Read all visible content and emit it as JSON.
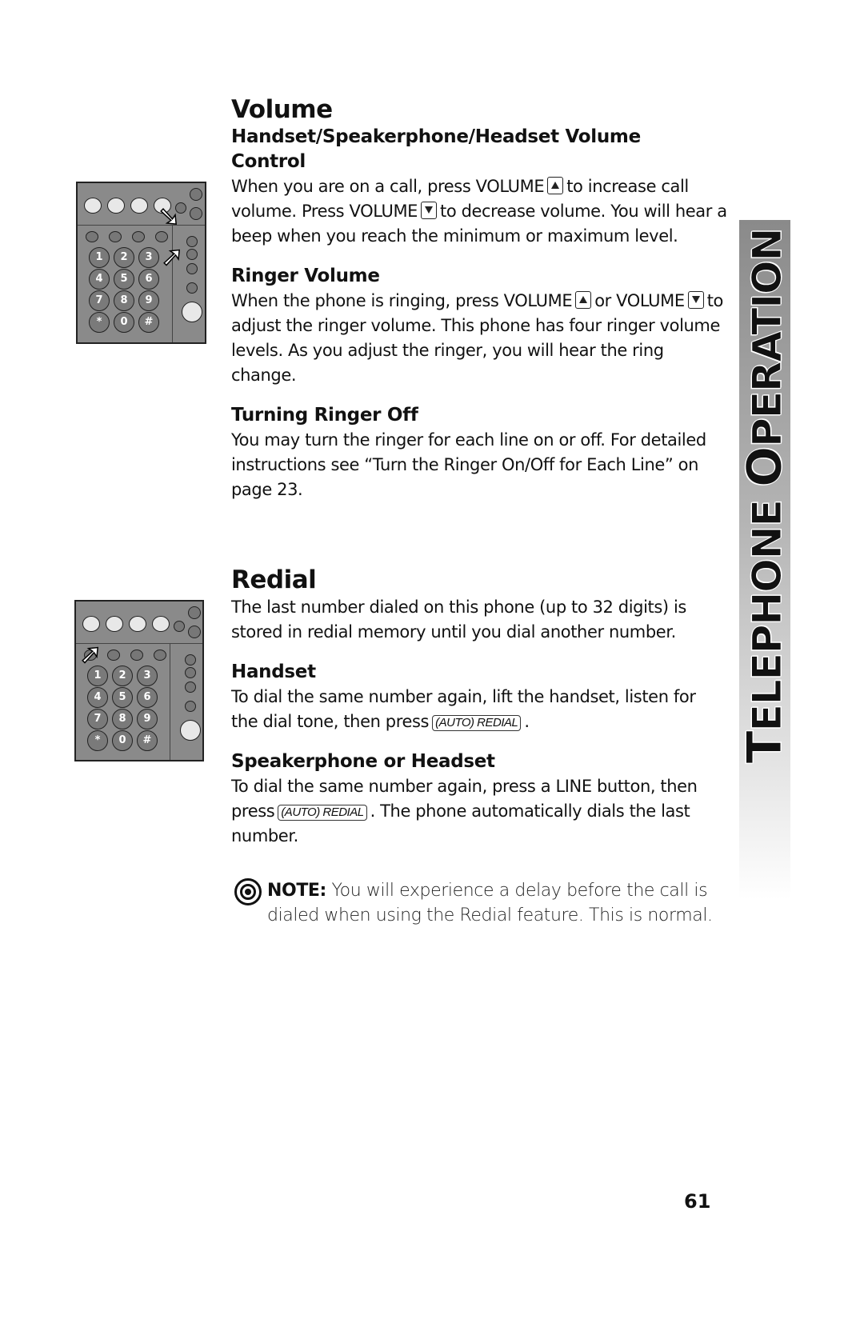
{
  "volume": {
    "title": "Volume",
    "handset_heading": "Handset/Speakerphone/Headset Volume Control",
    "handset_text_1": "When you are on a call, press VOLUME",
    "handset_text_2": "to increase call volume.  Press  VOLUME",
    "handset_text_3": "to decrease volume. You will hear a beep when you reach the minimum or maximum level.",
    "ringer_heading": "Ringer Volume",
    "ringer_text_1": "When the phone is ringing, press VOLUME",
    "ringer_text_2": "or VOLUME",
    "ringer_text_3": "to adjust the ringer volume. This phone has four ringer volume levels.  As you adjust the ringer, you will hear the ring change.",
    "off_heading": "Turning Ringer Off",
    "off_text": "You may turn the ringer for each line on or off.  For detailed instructions see “Turn the Ringer On/Off for Each Line” on page 23."
  },
  "redial": {
    "title": "Redial",
    "intro": "The last number dialed on this phone (up to 32 digits) is stored in redial memory until you dial another number.",
    "handset_heading": "Handset",
    "handset_text_1": "To dial the same number again, lift the handset, listen for the dial tone, then press",
    "handset_text_2": ".",
    "speaker_heading": "Speakerphone or Headset",
    "speaker_text_1": "To dial the same number again, press a LINE button, then press",
    "speaker_text_2": ".  The phone automatically dials the last number.",
    "button_label": "(AUTO) REDIAL"
  },
  "note": {
    "label": "NOTE:",
    "text": "You will experience a delay before the call is dialed when using the Redial feature.  This is normal."
  },
  "side_tab": {
    "first_letter": "T",
    "word1": "ELEPHONE",
    "second_letter": "O",
    "word2": "PERATION"
  },
  "page_number": "61",
  "keypad": [
    "1",
    "2",
    "3",
    "4",
    "5",
    "6",
    "7",
    "8",
    "9",
    "*",
    "0",
    "#"
  ],
  "icons": {
    "volume_up": "up-triangle-key",
    "volume_down": "down-triangle-key",
    "note": "target-icon"
  }
}
